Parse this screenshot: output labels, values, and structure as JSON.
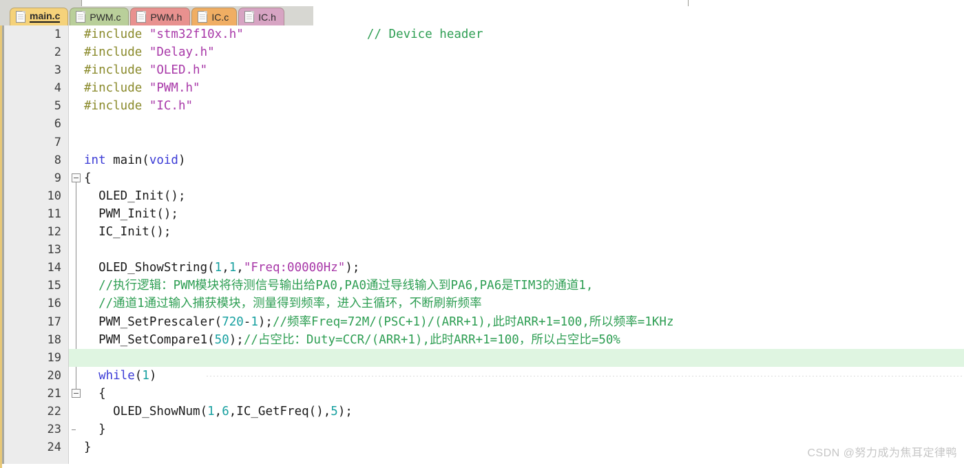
{
  "window": {
    "title_strip_present": true
  },
  "tabs": [
    {
      "label": "main.c",
      "icon": "file-icon",
      "active": true,
      "color": "#f5d27a"
    },
    {
      "label": "PWM.c",
      "icon": "file-icon",
      "active": false,
      "color": "#b9cf9a"
    },
    {
      "label": "PWM.h",
      "icon": "file-icon",
      "active": false,
      "color": "#e8918f"
    },
    {
      "label": "IC.c",
      "icon": "file-icon",
      "active": false,
      "color": "#f0ae63"
    },
    {
      "label": "IC.h",
      "icon": "file-icon",
      "active": false,
      "color": "#d7a4c3"
    }
  ],
  "editor": {
    "active_file": "main.c",
    "highlighted_line": 19,
    "fold_markers": [
      9,
      21
    ],
    "line_numbers": [
      "1",
      "2",
      "3",
      "4",
      "5",
      "6",
      "7",
      "8",
      "9",
      "10",
      "11",
      "12",
      "13",
      "14",
      "15",
      "16",
      "17",
      "18",
      "19",
      "20",
      "21",
      "22",
      "23",
      "24"
    ],
    "lines": [
      {
        "n": "1",
        "tokens": [
          {
            "t": "#include ",
            "c": "pre"
          },
          {
            "t": "\"stm32f10x.h\"",
            "c": "str"
          },
          {
            "t": "                 ",
            "c": "pln"
          },
          {
            "t": "// Device header",
            "c": "cmt"
          }
        ]
      },
      {
        "n": "2",
        "tokens": [
          {
            "t": "#include ",
            "c": "pre"
          },
          {
            "t": "\"Delay.h\"",
            "c": "str"
          }
        ]
      },
      {
        "n": "3",
        "tokens": [
          {
            "t": "#include ",
            "c": "pre"
          },
          {
            "t": "\"OLED.h\"",
            "c": "str"
          }
        ]
      },
      {
        "n": "4",
        "tokens": [
          {
            "t": "#include ",
            "c": "pre"
          },
          {
            "t": "\"PWM.h\"",
            "c": "str"
          }
        ]
      },
      {
        "n": "5",
        "tokens": [
          {
            "t": "#include ",
            "c": "pre"
          },
          {
            "t": "\"IC.h\"",
            "c": "str"
          }
        ]
      },
      {
        "n": "6",
        "tokens": [
          {
            "t": "",
            "c": "pln"
          }
        ]
      },
      {
        "n": "7",
        "tokens": [
          {
            "t": "",
            "c": "pln"
          }
        ]
      },
      {
        "n": "8",
        "tokens": [
          {
            "t": "int",
            "c": "kw"
          },
          {
            "t": " main(",
            "c": "pln"
          },
          {
            "t": "void",
            "c": "kw"
          },
          {
            "t": ")",
            "c": "pln"
          }
        ]
      },
      {
        "n": "9",
        "tokens": [
          {
            "t": "{",
            "c": "pln"
          }
        ]
      },
      {
        "n": "10",
        "tokens": [
          {
            "t": "  OLED_Init();",
            "c": "pln"
          }
        ]
      },
      {
        "n": "11",
        "tokens": [
          {
            "t": "  PWM_Init();",
            "c": "pln"
          }
        ]
      },
      {
        "n": "12",
        "tokens": [
          {
            "t": "  IC_Init();",
            "c": "pln"
          }
        ]
      },
      {
        "n": "13",
        "tokens": [
          {
            "t": "",
            "c": "pln"
          }
        ]
      },
      {
        "n": "14",
        "tokens": [
          {
            "t": "  OLED_ShowString(",
            "c": "pln"
          },
          {
            "t": "1",
            "c": "num"
          },
          {
            "t": ",",
            "c": "pln"
          },
          {
            "t": "1",
            "c": "num"
          },
          {
            "t": ",",
            "c": "pln"
          },
          {
            "t": "\"Freq:00000Hz\"",
            "c": "str"
          },
          {
            "t": ");",
            "c": "pln"
          }
        ]
      },
      {
        "n": "15",
        "tokens": [
          {
            "t": "  //执行逻辑：PWM模块将待测信号输出给PA0,PA0通过导线输入到PA6,PA6是TIM3的通道1,",
            "c": "cmt"
          }
        ]
      },
      {
        "n": "16",
        "tokens": [
          {
            "t": "  //通道1通过输入捕获模块，测量得到频率，进入主循环，不断刷新频率",
            "c": "cmt"
          }
        ]
      },
      {
        "n": "17",
        "tokens": [
          {
            "t": "  PWM_SetPrescaler(",
            "c": "pln"
          },
          {
            "t": "720",
            "c": "num"
          },
          {
            "t": "-",
            "c": "pln"
          },
          {
            "t": "1",
            "c": "num"
          },
          {
            "t": ");",
            "c": "pln"
          },
          {
            "t": "//频率Freq=72M/(PSC+1)/(ARR+1),此时ARR+1=100,所以频率=1KHz",
            "c": "cmt"
          }
        ]
      },
      {
        "n": "18",
        "tokens": [
          {
            "t": "  PWM_SetCompare1(",
            "c": "pln"
          },
          {
            "t": "50",
            "c": "num"
          },
          {
            "t": ");",
            "c": "pln"
          },
          {
            "t": "//占空比：Duty=CCR/(ARR+1),此时ARR+1=100，所以占空比=50%",
            "c": "cmt"
          }
        ]
      },
      {
        "n": "19",
        "tokens": [
          {
            "t": "",
            "c": "pln"
          }
        ]
      },
      {
        "n": "20",
        "tokens": [
          {
            "t": "  ",
            "c": "pln"
          },
          {
            "t": "while",
            "c": "kw"
          },
          {
            "t": "(",
            "c": "pln"
          },
          {
            "t": "1",
            "c": "num"
          },
          {
            "t": ")",
            "c": "pln"
          }
        ]
      },
      {
        "n": "21",
        "tokens": [
          {
            "t": "  {",
            "c": "pln"
          }
        ]
      },
      {
        "n": "22",
        "tokens": [
          {
            "t": "    OLED_ShowNum(",
            "c": "pln"
          },
          {
            "t": "1",
            "c": "num"
          },
          {
            "t": ",",
            "c": "pln"
          },
          {
            "t": "6",
            "c": "num"
          },
          {
            "t": ",IC_GetFreq(),",
            "c": "pln"
          },
          {
            "t": "5",
            "c": "num"
          },
          {
            "t": ");",
            "c": "pln"
          }
        ]
      },
      {
        "n": "23",
        "tokens": [
          {
            "t": "  }",
            "c": "pln"
          }
        ]
      },
      {
        "n": "24",
        "tokens": [
          {
            "t": "}",
            "c": "pln"
          }
        ]
      }
    ]
  },
  "watermark": {
    "text": "CSDN @努力成为焦耳定律鸭"
  },
  "colors": {
    "preprocessor": "#8a8a2b",
    "string": "#a838a8",
    "comment": "#2e9e53",
    "keyword": "#3b3bd6",
    "number": "#17a0a0",
    "plain": "#1a1a1a",
    "highlight_row": "#dff5e1",
    "gutter_bg": "#ececec",
    "tabbar_bg": "#d7d7d2",
    "active_tab_accent": "#e8c877"
  }
}
